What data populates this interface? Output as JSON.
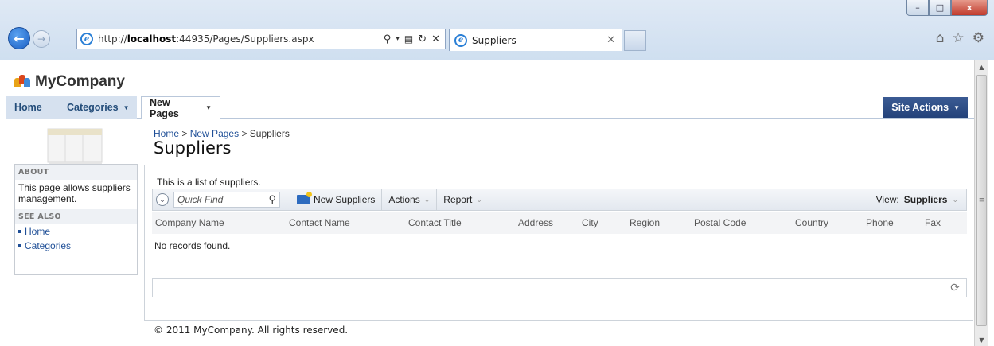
{
  "browser": {
    "url_prefix": "http://",
    "url_host": "localhost",
    "url_rest": ":44935/Pages/Suppliers.aspx",
    "tab_title": "Suppliers",
    "window_buttons": {
      "minimize": "–",
      "maximize": "□",
      "close": "x"
    }
  },
  "header": {
    "brand": "MyCompany",
    "menu": [
      {
        "label": "Home"
      },
      {
        "label": "Categories"
      },
      {
        "label": "New Pages"
      }
    ],
    "site_actions": "Site Actions"
  },
  "sidebar": {
    "about_title": "ABOUT",
    "about_text": "This page allows suppliers management.",
    "see_also_title": "SEE ALSO",
    "links": [
      {
        "label": "Home"
      },
      {
        "label": "Categories"
      }
    ]
  },
  "breadcrumb": {
    "home": "Home",
    "sep": ">",
    "section": "New Pages",
    "current": "Suppliers"
  },
  "page_title": "Suppliers",
  "content": {
    "description": "This is a list of suppliers.",
    "quick_find_placeholder": "Quick Find",
    "new_button": "New Suppliers",
    "actions_label": "Actions",
    "report_label": "Report",
    "view_label": "View:",
    "view_value": "Suppliers",
    "columns": [
      "Company Name",
      "Contact Name",
      "Contact Title",
      "Address",
      "City",
      "Region",
      "Postal Code",
      "Country",
      "Phone",
      "Fax"
    ],
    "empty_message": "No records found."
  },
  "footer": "© 2011 MyCompany. All rights reserved.",
  "colors": {
    "accent": "#23427a",
    "link": "#1f4f97",
    "menu_bg": "#d6e1ef"
  }
}
